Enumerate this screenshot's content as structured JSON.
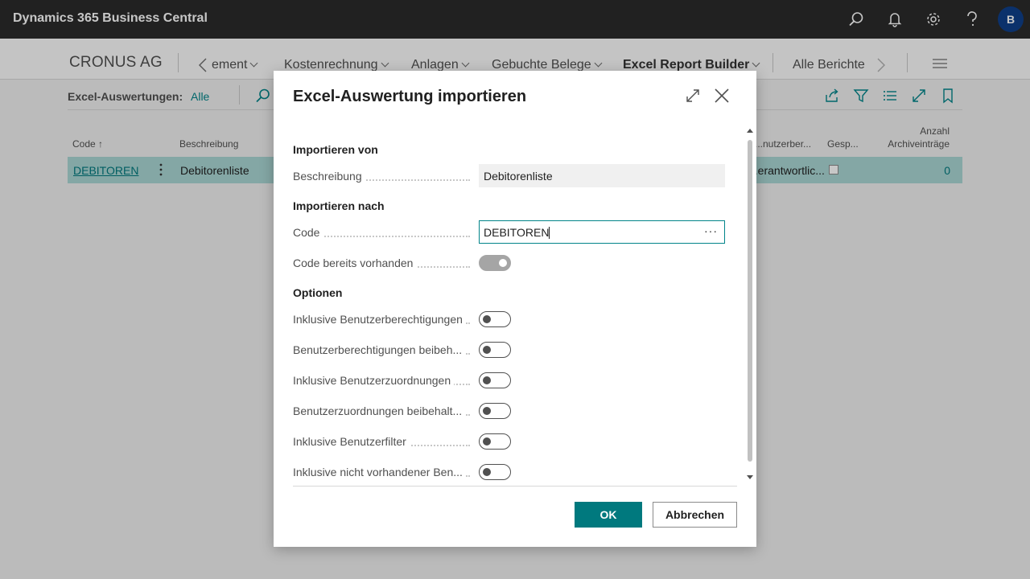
{
  "app": {
    "title": "Dynamics 365 Business Central",
    "avatar": "B"
  },
  "icons": {
    "search": "search-icon",
    "bell": "bell-icon",
    "settings": "gear-icon",
    "help": "help-icon"
  },
  "nav": {
    "company": "CRONUS AG",
    "items": [
      "ement",
      "Kostenrechnung",
      "Anlagen",
      "Gebuchte Belege",
      "Excel Report Builder",
      "Alle Berichte"
    ]
  },
  "actionbar": {
    "label": "Excel-Auswertungen:",
    "filter": "Alle"
  },
  "list": {
    "headers": {
      "code": "Code ↑",
      "description": "Beschreibung",
      "userperm": "...nutzerber...",
      "shared": "Gesp...",
      "count_line1": "Anzahl",
      "count_line2": "Archiveinträge"
    },
    "row": {
      "code": "DEBITOREN",
      "description": "Debitorenliste",
      "responsible": "...erantwortlic...",
      "count": "0"
    }
  },
  "dialog": {
    "title": "Excel-Auswertung importieren",
    "section_from": "Importieren von",
    "section_to": "Importieren nach",
    "section_options": "Optionen",
    "fields": {
      "description_label": "Beschreibung",
      "description_value": "Debitorenliste",
      "code_label": "Code",
      "code_value": "DEBITOREN",
      "code_exists_label": "Code bereits vorhanden"
    },
    "options": [
      {
        "label": "Inklusive Benutzerberechtigungen",
        "on": false
      },
      {
        "label": "Benutzerberechtigungen beibeh...",
        "on": false
      },
      {
        "label": "Inklusive Benutzerzuordnungen",
        "on": false
      },
      {
        "label": "Benutzerzuordnungen beibehalt...",
        "on": false
      },
      {
        "label": "Inklusive Benutzerfilter",
        "on": false
      },
      {
        "label": "Inklusive nicht vorhandener Ben...",
        "on": false
      }
    ],
    "ok": "OK",
    "cancel": "Abbrechen"
  }
}
